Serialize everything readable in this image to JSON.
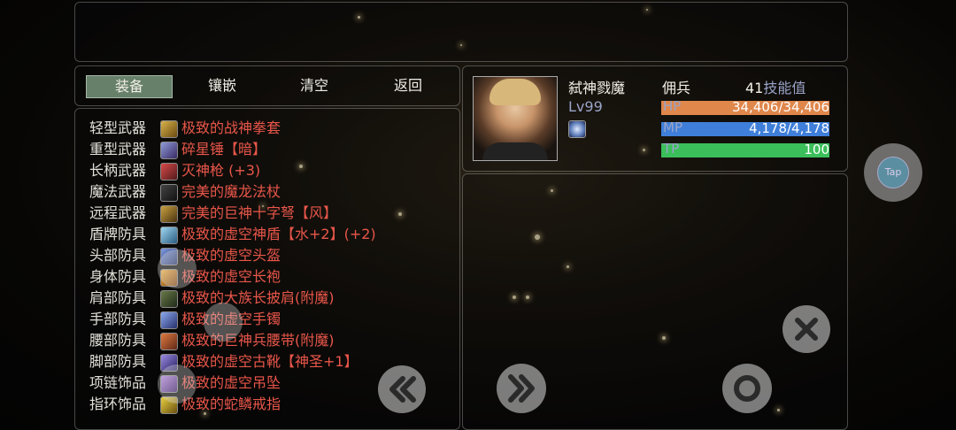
{
  "tabs": [
    {
      "label": "装备"
    },
    {
      "label": "镶嵌"
    },
    {
      "label": "清空"
    },
    {
      "label": "返回"
    }
  ],
  "equipment": [
    {
      "slot": "轻型武器",
      "item": "极致的战神拳套"
    },
    {
      "slot": "重型武器",
      "item": "碎星锤【暗】"
    },
    {
      "slot": "长柄武器",
      "item": "灭神枪 (+3)"
    },
    {
      "slot": "魔法武器",
      "item": "完美的魔龙法杖"
    },
    {
      "slot": "远程武器",
      "item": "完美的巨神十字弩【风】"
    },
    {
      "slot": "盾牌防具",
      "item": "极致的虚空神盾【水+2】(+2)"
    },
    {
      "slot": "头部防具",
      "item": "极致的虚空头盔"
    },
    {
      "slot": "身体防具",
      "item": "极致的虚空长袍"
    },
    {
      "slot": "肩部防具",
      "item": "极致的大族长披肩(附魔)"
    },
    {
      "slot": "手部防具",
      "item": "极致的虚空手镯"
    },
    {
      "slot": "腰部防具",
      "item": "极致的巨神兵腰带(附魔)"
    },
    {
      "slot": "脚部防具",
      "item": "极致的虚空古靴【神圣+1】"
    },
    {
      "slot": "项链饰品",
      "item": "极致的虚空吊坠"
    },
    {
      "slot": "指环饰品",
      "item": "极致的蛇鳞戒指"
    }
  ],
  "character": {
    "name": "弑神戮魔",
    "level": "Lv99",
    "class": "佣兵",
    "skill_points_value": "41",
    "skill_points_label": "技能值",
    "hp_label": "HP",
    "hp_value": "34,406/34,406",
    "hp_fill": 1.0,
    "mp_label": "MP",
    "mp_value": "4,178/4,178",
    "mp_fill": 1.0,
    "tp_label": "TP",
    "tp_value": "100",
    "tp_fill": 1.0
  },
  "floating_button": {
    "label": "Tap"
  },
  "colors": {
    "hp_bar": "#e0874b",
    "mp_bar": "#3f7fd9",
    "tp_bar": "#3bbf5a",
    "item_name": "#e8564a",
    "active_tab": "#67806a"
  },
  "icons": {
    "prev": "double-chevron-left-icon",
    "next": "double-chevron-right-icon",
    "close": "close-icon",
    "confirm": "circle-icon"
  }
}
